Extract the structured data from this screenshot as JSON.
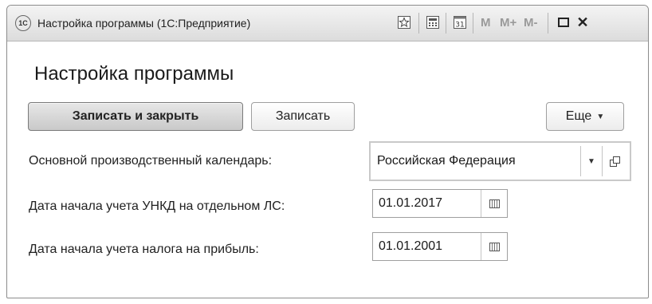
{
  "window": {
    "title": "Настройка программы  (1С:Предприятие)",
    "app_icon_text": "1С",
    "toolbar": {
      "favorite_icon": "star-icon",
      "calculator_icon": "calculator-icon",
      "calendar_icon": "calendar-icon",
      "m_label": "M",
      "m_plus_label": "M+",
      "m_minus_label": "M-",
      "maximize_icon": "maximize-icon",
      "close_label": "✕"
    }
  },
  "form": {
    "heading": "Настройка программы",
    "buttons": {
      "save_and_close": "Записать и закрыть",
      "save": "Записать",
      "more": "Еще"
    },
    "fields": {
      "calendar": {
        "label": "Основной производственный календарь:",
        "value": "Российская Федерация"
      },
      "unkd_date": {
        "label": "Дата начала учета УНКД на отдельном ЛС:",
        "value": "01.01.2017"
      },
      "profit_tax_date": {
        "label": "Дата начала учета налога на прибыль:",
        "value": "01.01.2001"
      }
    }
  }
}
